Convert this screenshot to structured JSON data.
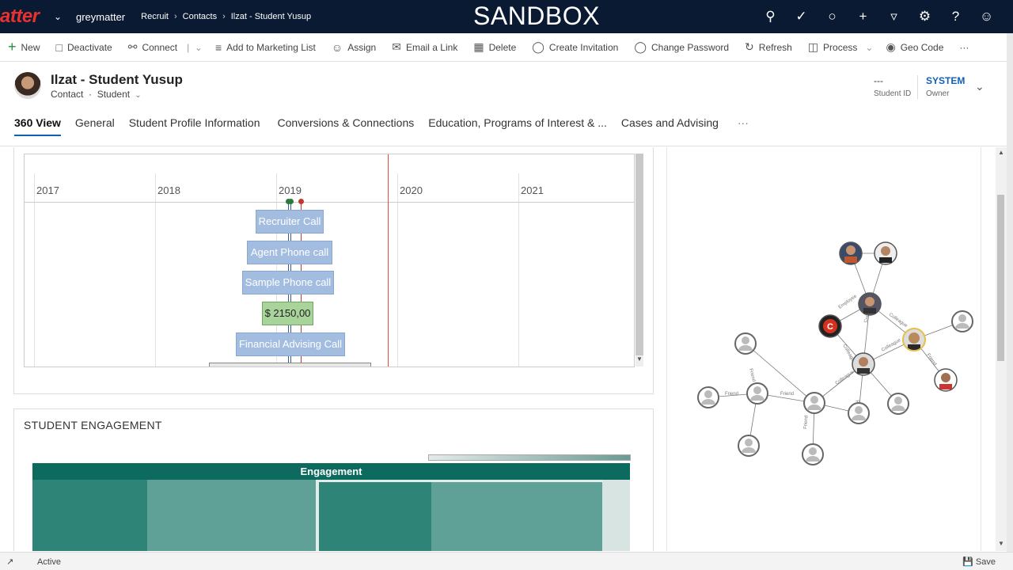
{
  "topnav": {
    "brand": "atter",
    "app_name": "greymatter",
    "breadcrumb": [
      "Recruit",
      "Contacts",
      "Ilzat - Student Yusup"
    ],
    "environment_banner": "SANDBOX",
    "icons": [
      "search-icon",
      "task-icon",
      "lightbulb-icon",
      "plus-icon",
      "filter-icon",
      "settings-icon",
      "help-icon",
      "user-icon"
    ]
  },
  "commands": [
    {
      "label": "New",
      "icon": "plus-icon"
    },
    {
      "label": "Deactivate",
      "icon": "deactivate-icon"
    },
    {
      "label": "Connect",
      "icon": "connect-icon"
    },
    {
      "label": "Add to Marketing List",
      "icon": "list-add-icon"
    },
    {
      "label": "Assign",
      "icon": "assign-icon"
    },
    {
      "label": "Email a Link",
      "icon": "email-icon"
    },
    {
      "label": "Delete",
      "icon": "trash-icon"
    },
    {
      "label": "Create Invitation",
      "icon": "invitation-icon"
    },
    {
      "label": "Change Password",
      "icon": "password-icon"
    },
    {
      "label": "Refresh",
      "icon": "refresh-icon"
    },
    {
      "label": "Process",
      "icon": "process-icon"
    },
    {
      "label": "Geo Code",
      "icon": "map-pin-icon"
    }
  ],
  "record": {
    "title": "Ilzat - Student Yusup",
    "entity": "Contact",
    "form": "Student",
    "student_id_value": "---",
    "student_id_label": "Student ID",
    "owner_value": "SYSTEM",
    "owner_label": "Owner"
  },
  "tabs": [
    "360 View",
    "General",
    "Student Profile Information",
    "Conversions & Connections",
    "Education, Programs of Interest & ...",
    "Cases and Advising"
  ],
  "timeline": {
    "years": [
      "2017",
      "2018",
      "2019",
      "2020",
      "2021"
    ],
    "events": [
      "Recruiter Call",
      "Agent Phone call",
      "Sample Phone call",
      "$ 2150,00",
      "Financial Advising Call"
    ]
  },
  "engagement": {
    "section_title": "STUDENT ENGAGEMENT",
    "header": "Engagement"
  },
  "network": {
    "edge_labels": [
      "Friend",
      "Friend",
      "Friend",
      "Friend",
      "Colleague",
      "Colleague",
      "Colleague",
      "Colleague",
      "Colleague",
      "Employee",
      "Relative",
      "Friend"
    ]
  },
  "status": {
    "state": "Active",
    "save_label": "Save"
  },
  "colors": {
    "nav_bg": "#0a1a33",
    "brand": "#e8322e",
    "accent": "#1160b7",
    "engagement_dark": "#0c6b5e",
    "engagement_mid": "#2e8477",
    "engagement_light": "#5fa097",
    "timeline_now": "#e74c3c"
  }
}
